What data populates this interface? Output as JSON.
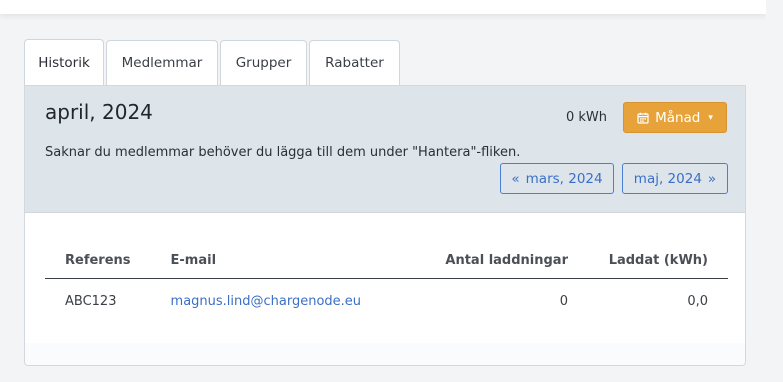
{
  "tabs": [
    {
      "label": "Historik",
      "active": true
    },
    {
      "label": "Medlemmar",
      "active": false
    },
    {
      "label": "Grupper",
      "active": false
    },
    {
      "label": "Rabatter",
      "active": false
    }
  ],
  "header": {
    "month_title": "april, 2024",
    "kwh_total": "0 kWh",
    "period_button": "Månad",
    "hint": "Saknar du medlemmar behöver du lägga till dem under \"Hantera\"-fliken.",
    "prev_button": "mars, 2024",
    "next_button": "maj, 2024",
    "prev_glyph": "«",
    "next_glyph": "»"
  },
  "table": {
    "columns": [
      "Referens",
      "E-mail",
      "Antal laddningar",
      "Laddat (kWh)"
    ],
    "rows": [
      {
        "referens": "ABC123",
        "email": "magnus.lind@chargenode.eu",
        "antal": "0",
        "laddat": "0,0"
      }
    ]
  },
  "colors": {
    "accent_orange": "#e8a23a",
    "link_blue": "#3b6fc6",
    "header_bg": "#dde4ea"
  },
  "icons": {
    "period_button": "calendar-icon",
    "period_chevron": "chevron-down-icon"
  }
}
